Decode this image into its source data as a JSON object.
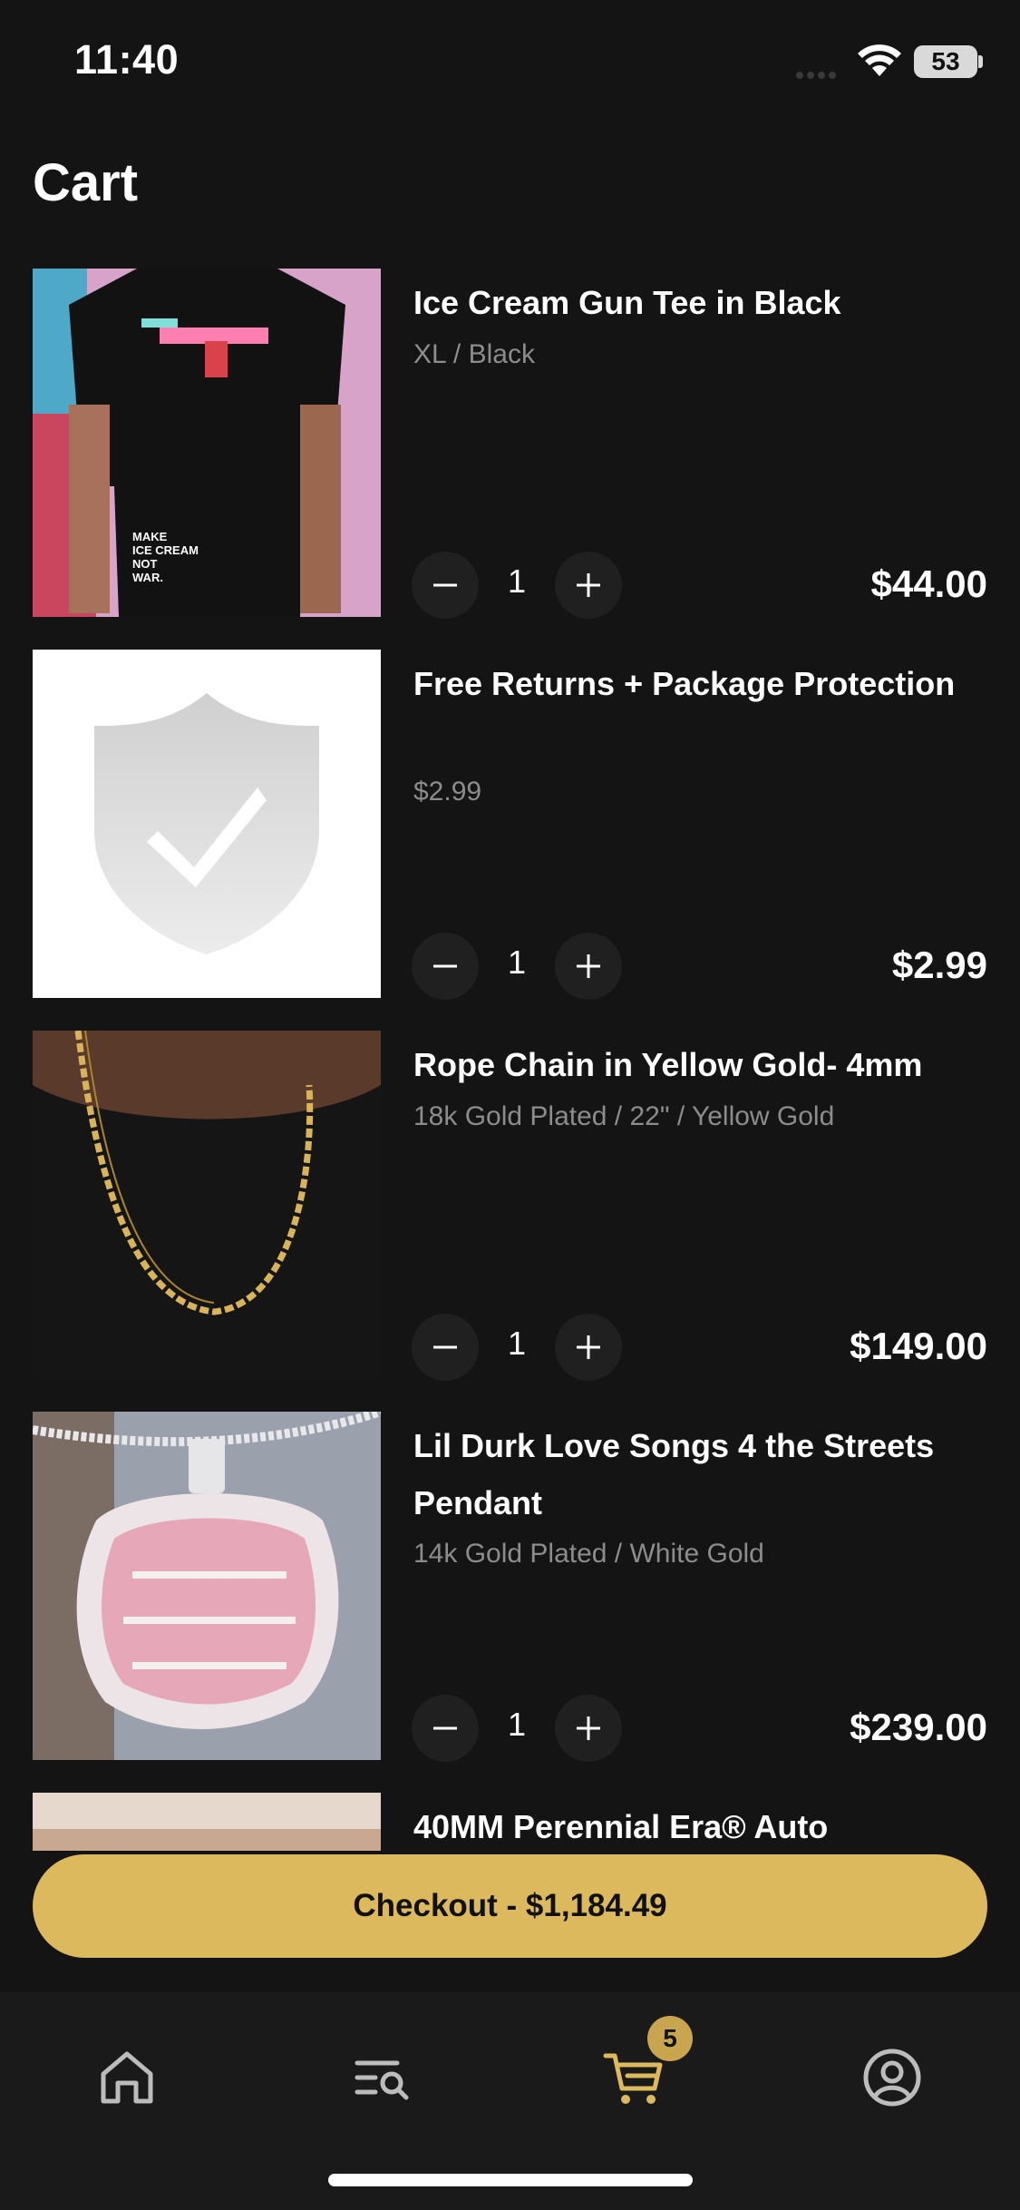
{
  "status_bar": {
    "time": "11:40",
    "battery": "53"
  },
  "page_title": "Cart",
  "items": [
    {
      "name": "Ice Cream Gun Tee in Black",
      "variant": "XL / Black",
      "quantity": "1",
      "price": "$44.00",
      "image": "t-shirt-photo"
    },
    {
      "name": "Free Returns + Package Protection",
      "variant": "$2.99",
      "quantity": "1",
      "price": "$2.99",
      "image": "shield-check-icon"
    },
    {
      "name": "Rope Chain in Yellow Gold- 4mm",
      "variant": "18k Gold Plated / 22\" / Yellow Gold",
      "quantity": "1",
      "price": "$149.00",
      "image": "rope-chain-photo"
    },
    {
      "name": "Lil Durk Love Songs 4 the Streets Pendant",
      "variant": "14k Gold Plated / White Gold",
      "quantity": "1",
      "price": "$239.00",
      "image": "pendant-photo"
    },
    {
      "name": "40MM Perennial Era® Auto",
      "image": "watch-photo"
    }
  ],
  "checkout": {
    "label": "Checkout - $1,184.49"
  },
  "tab_bar": {
    "tabs": [
      {
        "name": "home",
        "icon": "home-icon"
      },
      {
        "name": "search",
        "icon": "search-list-icon"
      },
      {
        "name": "cart",
        "icon": "cart-icon",
        "active": true
      },
      {
        "name": "account",
        "icon": "account-icon"
      }
    ],
    "cart_badge": "5"
  },
  "colors": {
    "background": "#141414",
    "accent": "#dcb95c",
    "muted_text": "#8c8c8c"
  }
}
